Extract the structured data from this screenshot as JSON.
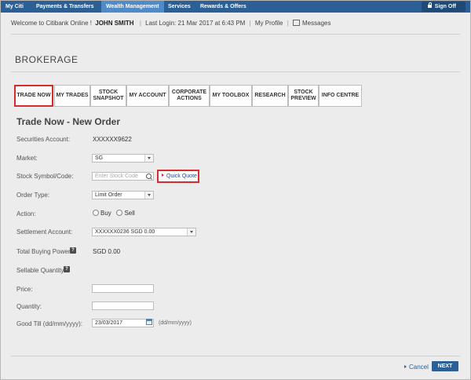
{
  "topnav": {
    "items": [
      "My Citi",
      "Payments & Transfers",
      "Wealth Management",
      "Services",
      "Rewards & Offers"
    ],
    "signoff": "Sign Off"
  },
  "welcome": {
    "greeting": "Welcome to Citibank Online !",
    "name": "JOHN SMITH",
    "last_login": "Last Login: 21 Mar 2017 at 6:43 PM",
    "profile": "My Profile",
    "messages": "Messages"
  },
  "section_title": "BROKERAGE",
  "tabs": [
    {
      "label": "TRADE NOW"
    },
    {
      "label": "MY TRADES"
    },
    {
      "label": "STOCK SNAPSHOT"
    },
    {
      "label": "MY ACCOUNT"
    },
    {
      "label": "CORPORATE ACTIONS"
    },
    {
      "label": "MY TOOLBOX"
    },
    {
      "label": "RESEARCH"
    },
    {
      "label": "STOCK PREVIEW"
    },
    {
      "label": "INFO CENTRE"
    }
  ],
  "form": {
    "title": "Trade Now - New Order",
    "securities_account_label": "Securities Account:",
    "securities_account_value": "XXXXXX9622",
    "market_label": "Market:",
    "market_value": "SG",
    "stock_symbol_label": "Stock Symbol/Code:",
    "stock_symbol_placeholder": "Enter Stock Code",
    "quick_quote": "Quick Quote",
    "order_type_label": "Order Type:",
    "order_type_value": "Limit Order",
    "action_label": "Action:",
    "action_buy": "Buy",
    "action_sell": "Sell",
    "settlement_label": "Settlement Account:",
    "settlement_value": "XXXXXX0236 SGD 0.00",
    "total_buying_power_label": "Total Buying Power:",
    "total_buying_power_value": "SGD 0.00",
    "sellable_quantity_label": "Sellable Quantity:",
    "price_label": "Price:",
    "price_value": "",
    "quantity_label": "Quantity:",
    "quantity_value": "",
    "good_till_label": "Good Till (dd/mm/yyyy):",
    "good_till_value": "23/03/2017",
    "good_till_hint": "(dd/mm/yyyy)",
    "help_glyph": "?"
  },
  "footer": {
    "cancel": "Cancel",
    "next": "NEXT"
  },
  "colors": {
    "nav_bg": "#2b5f96",
    "nav_active": "#4f8ac9",
    "highlight": "#d62c2c"
  }
}
